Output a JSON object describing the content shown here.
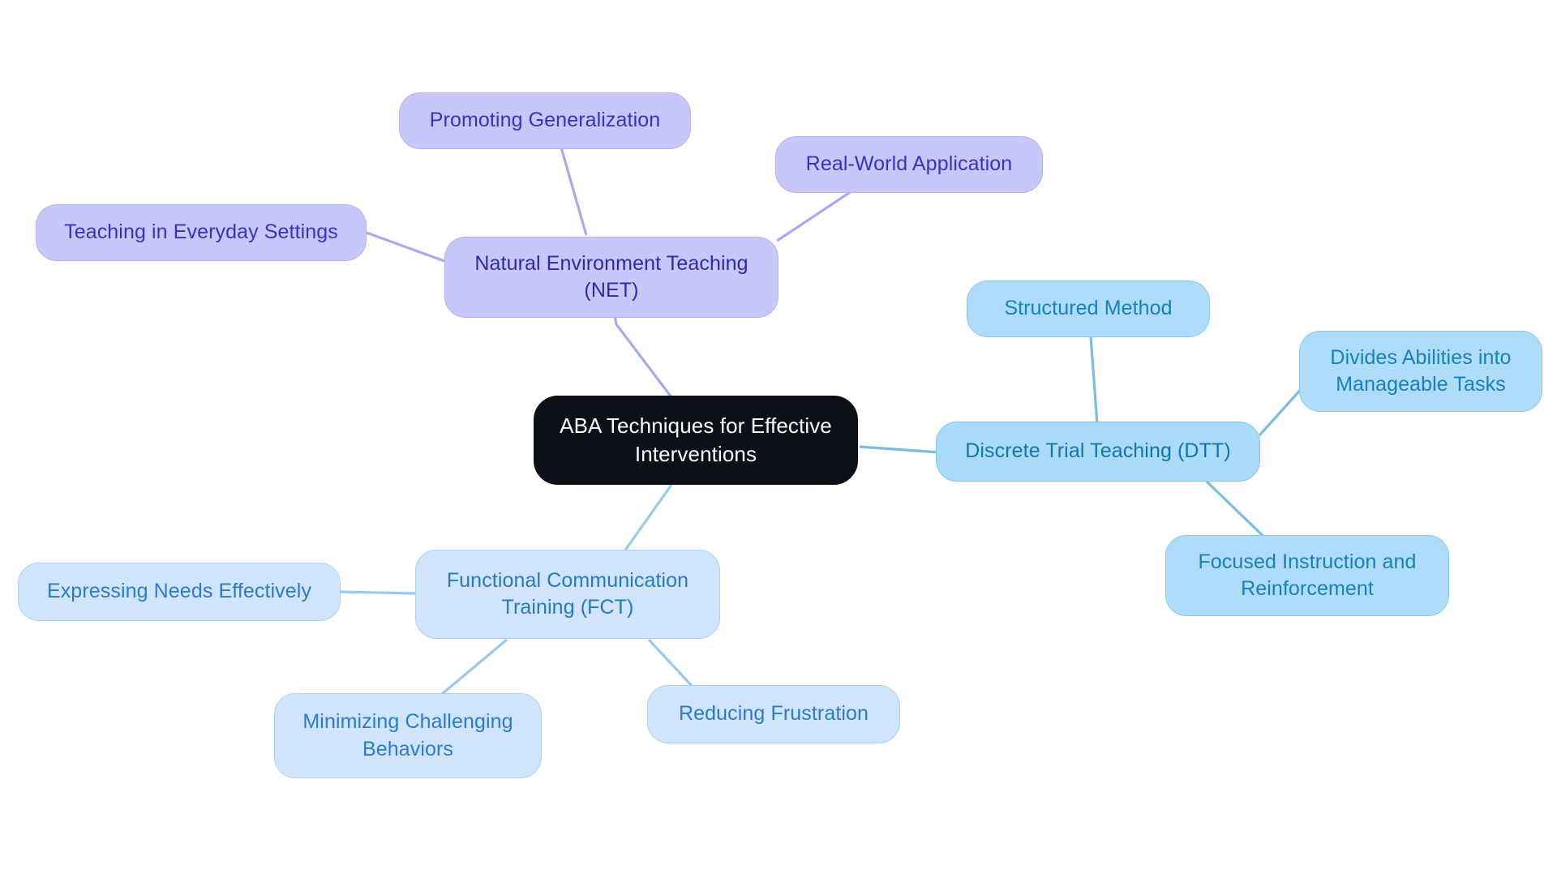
{
  "diagram": {
    "type": "mindmap",
    "title": "ABA Techniques for Effective Interventions",
    "background_color": "#ffffff",
    "root": {
      "id": "root",
      "label": "ABA Techniques for Effective\nInterventions",
      "fill": "#0c1117",
      "text_color": "#ffffff"
    },
    "branches": [
      {
        "id": "net",
        "label": "Natural Environment Teaching\n(NET)",
        "fill": "#c7c7fb",
        "text_color": "#2b2ba8",
        "edge_color": "#a9a9f0",
        "children": [
          {
            "id": "net-everyday",
            "label": "Teaching in Everyday Settings",
            "fill": "#c7c7fb",
            "text_color": "#3434c4"
          },
          {
            "id": "net-generalization",
            "label": "Promoting Generalization",
            "fill": "#c7c7fb",
            "text_color": "#3434c4"
          },
          {
            "id": "net-realworld",
            "label": "Real-World Application",
            "fill": "#c7c7fb",
            "text_color": "#3434c4"
          }
        ]
      },
      {
        "id": "dtt",
        "label": "Discrete Trial Teaching (DTT)",
        "fill": "#aadbf8",
        "text_color": "#1176ad",
        "edge_color": "#79bde2",
        "children": [
          {
            "id": "dtt-structured",
            "label": "Structured Method",
            "fill": "#aedcf9",
            "text_color": "#1781bb"
          },
          {
            "id": "dtt-divides",
            "label": "Divides Abilities into\nManageable Tasks",
            "fill": "#aedcf9",
            "text_color": "#1781bb"
          },
          {
            "id": "dtt-focused",
            "label": "Focused Instruction and\nReinforcement",
            "fill": "#aedcf9",
            "text_color": "#1781bb"
          }
        ]
      },
      {
        "id": "fct",
        "label": "Functional Communication\nTraining (FCT)",
        "fill": "#d0e5fb",
        "text_color": "#2a78c2",
        "edge_color": "#9cc8ec",
        "children": [
          {
            "id": "fct-expressing",
            "label": "Expressing Needs Effectively",
            "fill": "#d0e5fb",
            "text_color": "#2a7ccb"
          },
          {
            "id": "fct-minimizing",
            "label": "Minimizing Challenging\nBehaviors",
            "fill": "#d0e5fb",
            "text_color": "#2a7ccb"
          },
          {
            "id": "fct-reducing",
            "label": "Reducing Frustration",
            "fill": "#d0e5fb",
            "text_color": "#2a7ccb"
          }
        ]
      }
    ]
  }
}
